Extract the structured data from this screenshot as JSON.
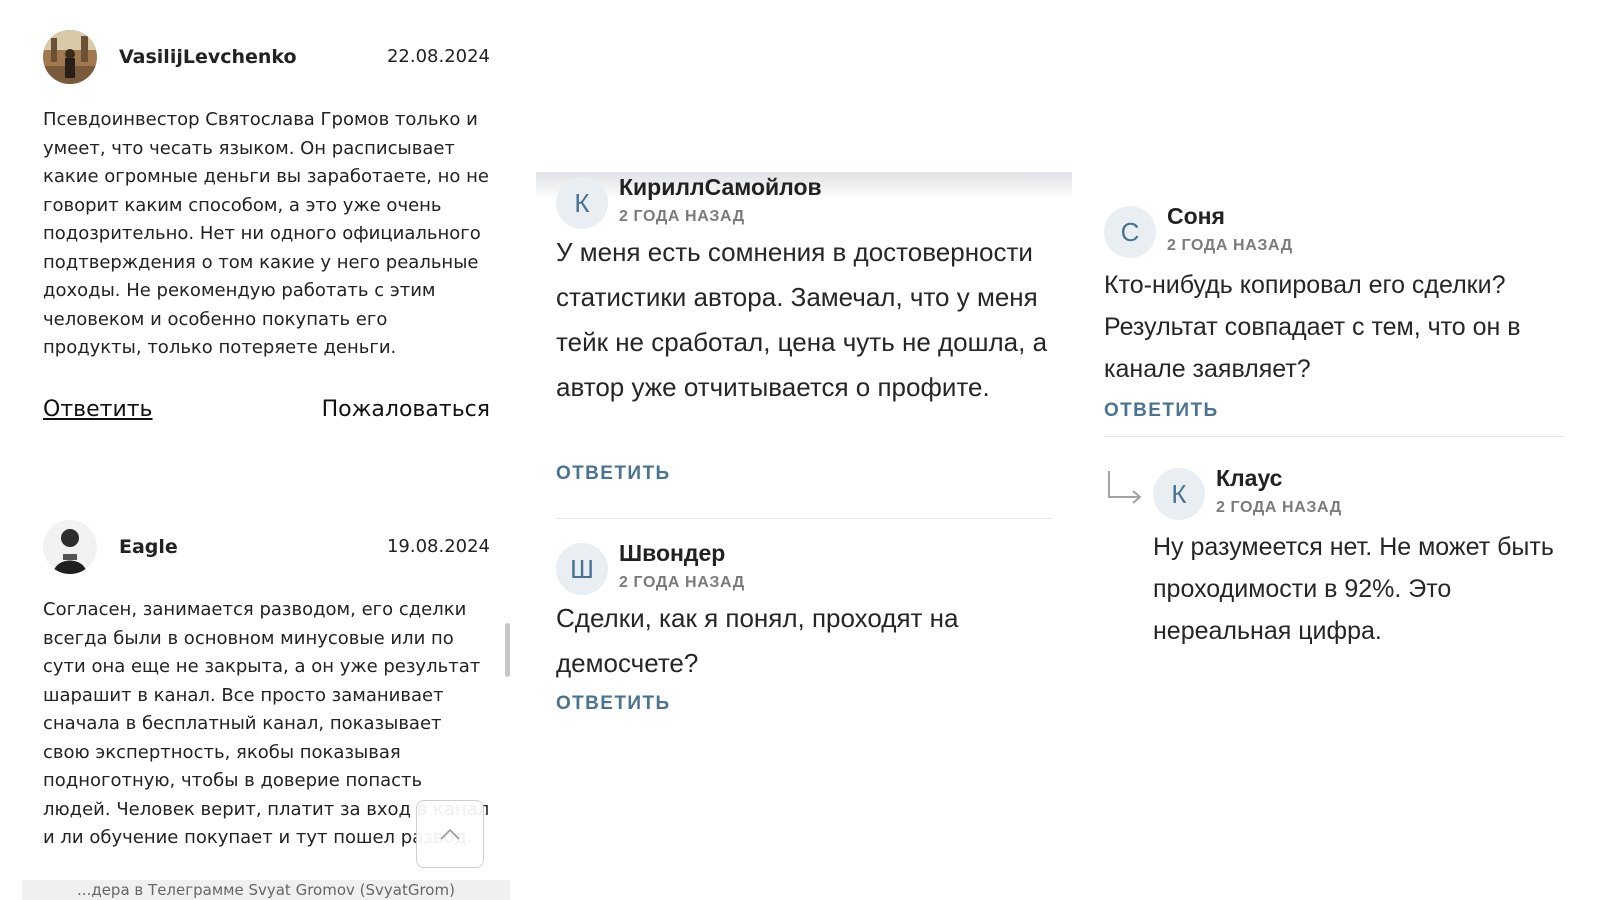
{
  "left_panel": {
    "comments": [
      {
        "author": "VasilijLevchenko",
        "date": "22.08.2024",
        "text": "Псевдоинвестор Святослава Громов только и умеет, что чесать языком. Он расписывает какие огромные деньги вы заработаете, но не говорит каким способом, а это уже очень подозрительно. Нет ни одного официального подтверждения о том какие у него реальные доходы. Не рекомендую работать с этим человеком и особенно покупать его продукты, только потеряете деньги.",
        "reply_label": "Ответить",
        "report_label": "Пожаловаться"
      },
      {
        "author": "Eagle",
        "date": "19.08.2024",
        "text": "Согласен, занимается разводом, его сделки всегда были в основном минусовые или по сути она еще не закрыта, а он уже результат шарашит в канал. Все просто заманивает сначала в бесплатный канал, показывает свою экспертность, якобы показывая подноготную, чтобы в доверие попасть людей. Человек верит, платит за вход в канал и ли обучение покупает и тут пошел развод. И получается, что реальных честных трейдеров очень сложно найти сейчас, жалко конечно!"
      }
    ],
    "footer_text": "...дера в Телеграмме Svyat Gromov (SvyatGrom)"
  },
  "middle_panel": {
    "comments": [
      {
        "avatar_letter": "К",
        "author": "КириллСамойлов",
        "time": "2 ГОДА НАЗАД",
        "text": "У меня есть сомнения в достоверности статистики автора. Замечал, что у меня тейк не сработал, цена чуть не дошла, а автор уже отчитывается о профите.",
        "reply_label": "ОТВЕТИТЬ"
      },
      {
        "avatar_letter": "Ш",
        "author": "Швондер",
        "time": "2 ГОДА НАЗАД",
        "text": "Сделки, как я понял, проходят на демосчете?",
        "reply_label": "ОТВЕТИТЬ"
      }
    ]
  },
  "right_panel": {
    "comments": [
      {
        "avatar_letter": "С",
        "author": "Соня",
        "time": "2 ГОДА НАЗАД",
        "text": "Кто-нибудь копировал его сделки? Результат совпадает с тем, что он в канале заявляет?",
        "reply_label": "ОТВЕТИТЬ"
      },
      {
        "avatar_letter": "К",
        "author": "Клаус",
        "time": "2 ГОДА НАЗАД",
        "text": "Ну разумеется нет. Не может быть проходимости в 92%. Это нереальная цифра."
      }
    ]
  },
  "colors": {
    "accent": "#4a7391",
    "avatar_bg": "#e9eef3",
    "meta_gray": "#7b7b7b",
    "divider": "#e5e5e5"
  },
  "icons": [
    "user-photo-avatar",
    "chevron-up-icon",
    "reply-arrow-icon"
  ]
}
